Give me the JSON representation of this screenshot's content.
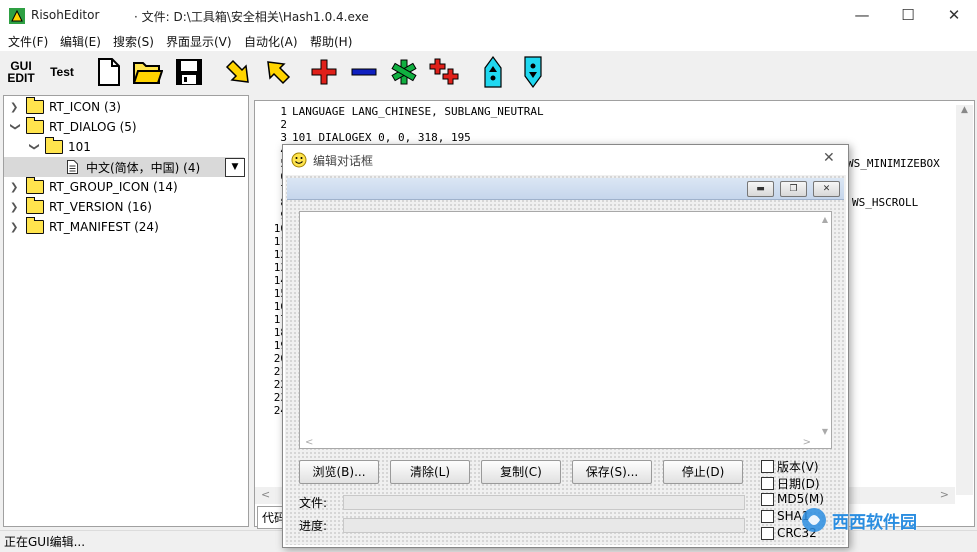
{
  "window": {
    "app_name": "RisohEditor",
    "file_label": "· 文件: D:\\工具箱\\安全相关\\Hash1.0.4.exe",
    "controls": {
      "minimize": "—",
      "maximize": "☐",
      "close": "✕"
    }
  },
  "menu": [
    "文件(F)",
    "编辑(E)",
    "搜索(S)",
    "界面显示(V)",
    "自动化(A)",
    "帮助(H)"
  ],
  "toolbar": {
    "gui_edit": "GUI\nEDIT",
    "test": "Test",
    "colors": {
      "plus": "#e0201a",
      "minus": "#1020c0",
      "star": "#10b040",
      "arrow_yellow": "#ffd400",
      "arrow_cyan": "#20d8f0"
    }
  },
  "tree": [
    {
      "label": "RT_ICON (3)",
      "expanded": false
    },
    {
      "label": "RT_DIALOG (5)",
      "expanded": true
    },
    {
      "label": "101",
      "expanded": true
    },
    {
      "label": "中文(简体，中国) (4)",
      "selected": true
    },
    {
      "label": "RT_GROUP_ICON (14)",
      "expanded": false
    },
    {
      "label": "RT_VERSION (16)",
      "expanded": false
    },
    {
      "label": "RT_MANIFEST (24)",
      "expanded": false
    }
  ],
  "editor": {
    "line_numbers": "1\n2\n3\n4\n5\n6\n7\n8\n9\n10\n11\n12\n13\n14\n15\n16\n17\n18\n19\n20\n21\n22\n23\n24",
    "code": "LANGUAGE LANG_CHINESE, SUBLANG_NEUTRAL\n\n101 DIALOGEX 0, 0, 318, 195",
    "partial_right_1": "WS_MINIMIZEBOX",
    "partial_right_2": "WS_HSCROLL",
    "tab_label": "代码"
  },
  "status": "正在GUI编辑...",
  "dialog": {
    "title": "编辑对话框",
    "close": "✕",
    "buttons": [
      "浏览(B)...",
      "清除(L)",
      "复制(C)",
      "保存(S)...",
      "停止(D)"
    ],
    "checkboxes": [
      "版本(V)",
      "日期(D)",
      "MD5(M)",
      "SHA1",
      "CRC32"
    ],
    "file_label": "文件:",
    "progress_label": "进度:"
  },
  "watermark": "西西软件园"
}
